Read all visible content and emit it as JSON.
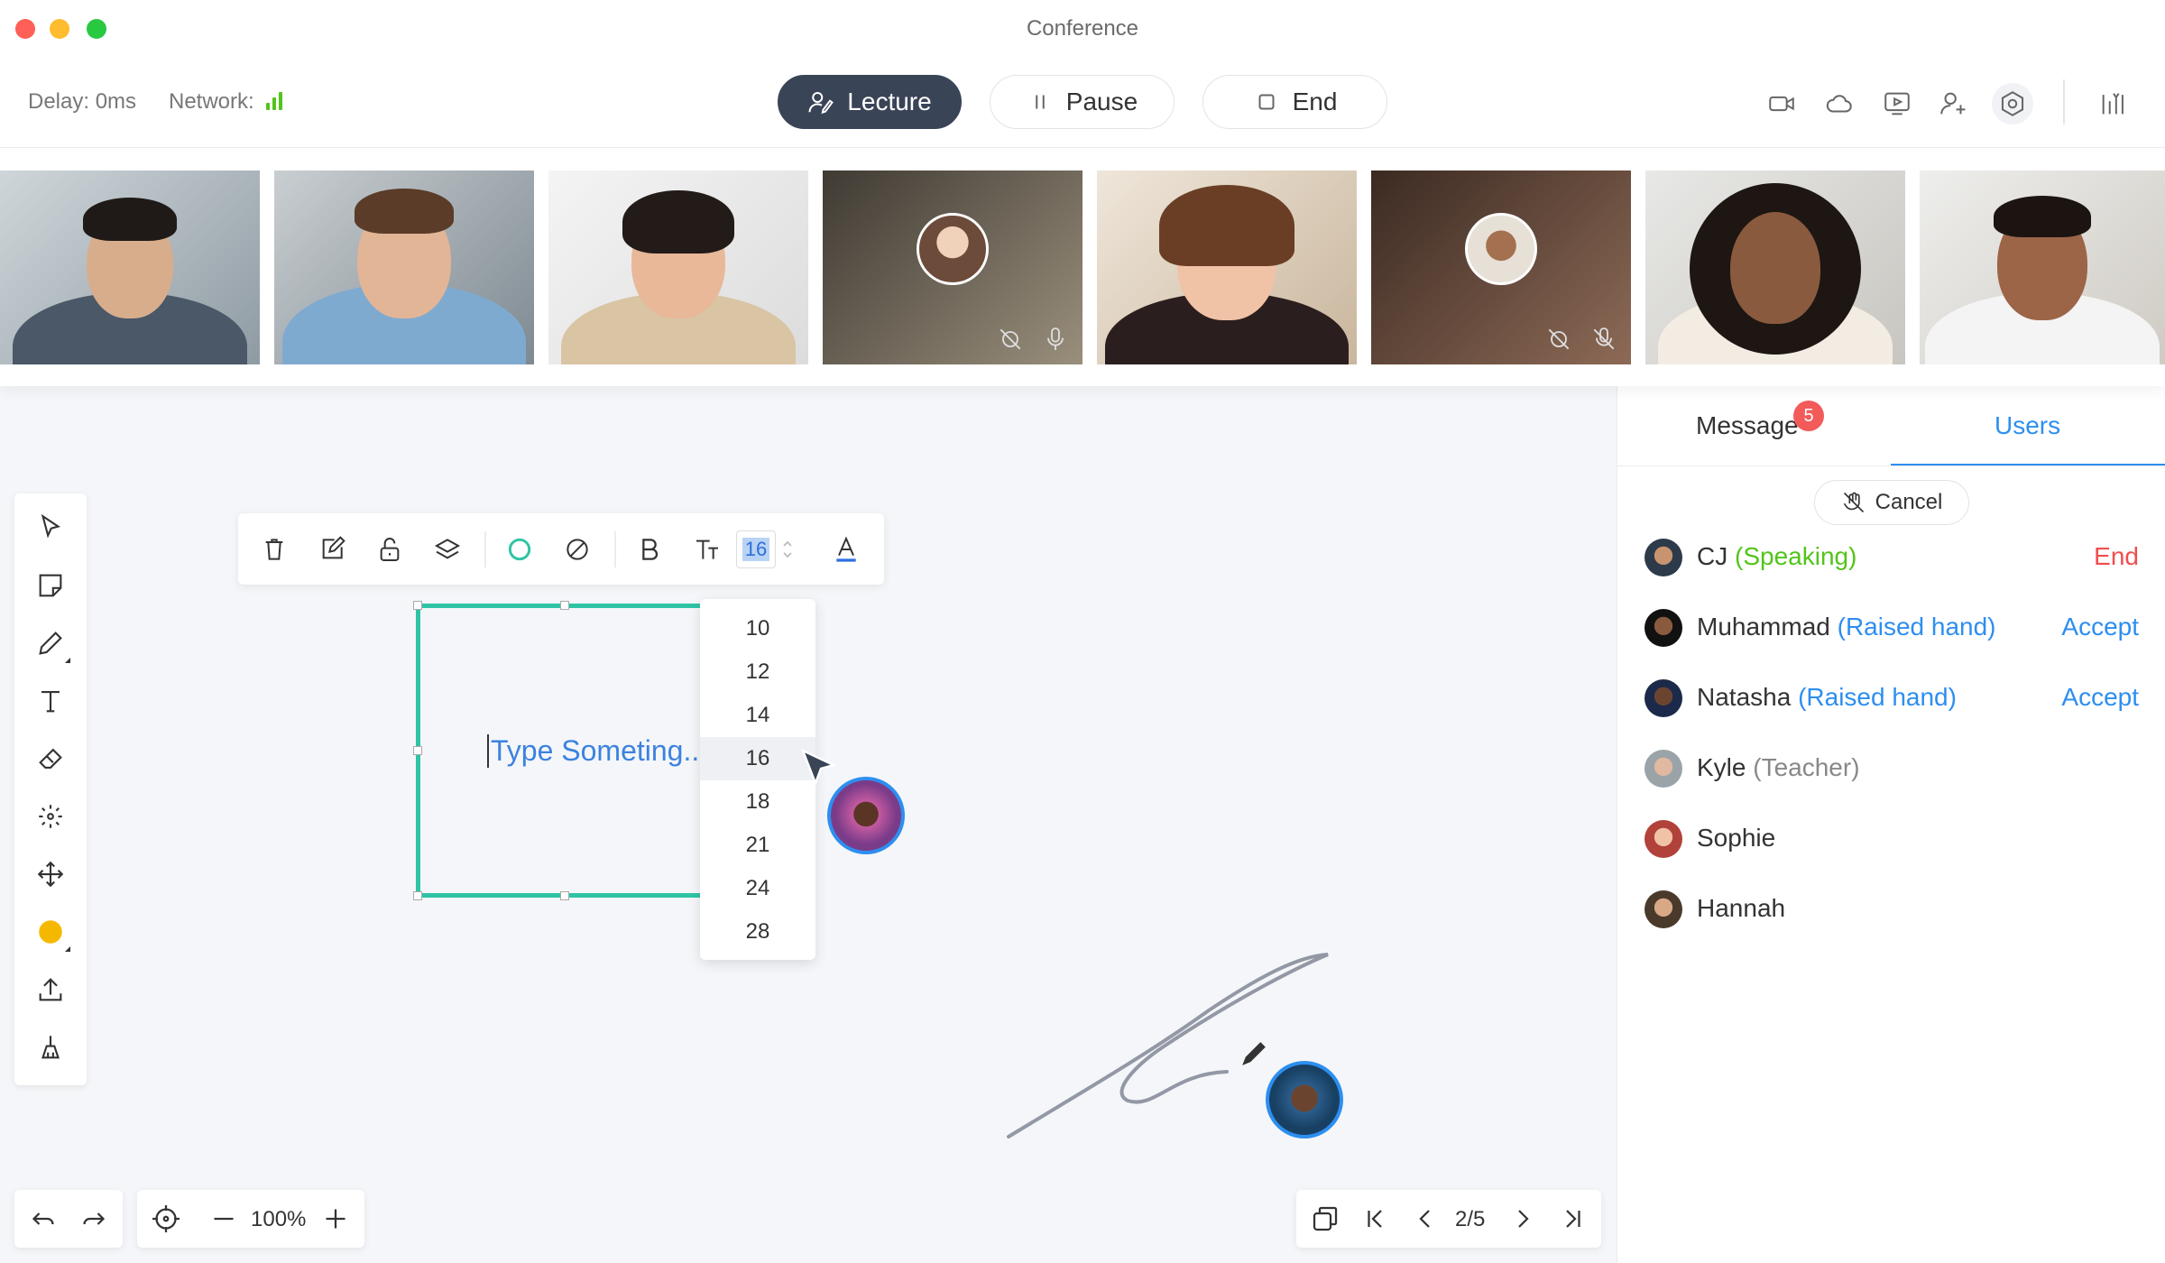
{
  "window": {
    "title": "Conference"
  },
  "toolbar": {
    "delay_label": "Delay: 0ms",
    "network_label": "Network:",
    "lecture_label": "Lecture",
    "pause_label": "Pause",
    "end_label": "End"
  },
  "format": {
    "font_size": "16",
    "font_sizes": [
      "10",
      "12",
      "14",
      "16",
      "18",
      "21",
      "24",
      "28"
    ],
    "selected_size": "16"
  },
  "textbox": {
    "placeholder": "Type Someting.."
  },
  "zoom": {
    "level": "100%"
  },
  "pages": {
    "indicator": "2/5"
  },
  "panel": {
    "tab_messages": "Message",
    "tab_users": "Users",
    "unread_badge": "5",
    "cancel_label": "Cancel",
    "users": [
      {
        "name": "CJ",
        "status": "(Speaking)",
        "action": "End"
      },
      {
        "name": "Muhammad",
        "status": "(Raised hand)",
        "action": "Accept"
      },
      {
        "name": "Natasha",
        "status": "(Raised hand)",
        "action": "Accept"
      },
      {
        "name": "Kyle",
        "status": "(Teacher)",
        "action": ""
      },
      {
        "name": "Sophie",
        "status": "",
        "action": ""
      },
      {
        "name": "Hannah",
        "status": "",
        "action": ""
      }
    ]
  },
  "colors": {
    "accent": "#2d8ef0",
    "selection": "#2ec4a5",
    "speaking": "#52c41a",
    "danger": "#f04d4d",
    "lecture_button": "#3a4457"
  }
}
